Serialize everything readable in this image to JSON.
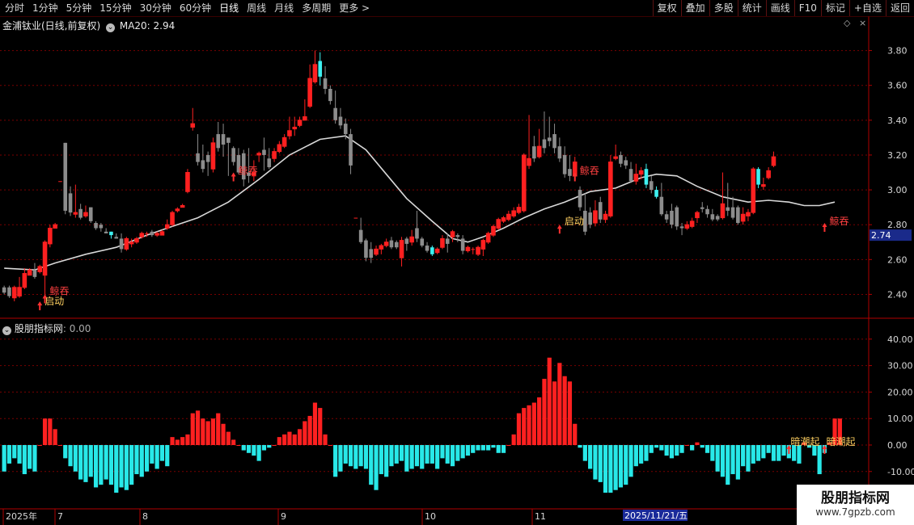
{
  "toolbar": {
    "periods": [
      "分时",
      "1分钟",
      "5分钟",
      "15分钟",
      "30分钟",
      "60分钟",
      "日线",
      "周线",
      "月线",
      "多周期",
      "更多 >"
    ],
    "active_period": "日线",
    "actions": [
      "复权",
      "叠加",
      "多股",
      "统计",
      "画线",
      "F10",
      "标记",
      "+自选",
      "返回"
    ]
  },
  "stock": {
    "name": "金浦钛业(日线,前复权)",
    "ma_label": "MA20: 2.94"
  },
  "indicator": {
    "name": "股朋指标网",
    "value": ": 0.00"
  },
  "price_axis": {
    "ticks": [
      "3.80",
      "3.60",
      "3.40",
      "3.20",
      "3.00",
      "2.80",
      "2.60",
      "2.40"
    ],
    "current": "2.74",
    "range": [
      2.3,
      3.9
    ]
  },
  "osc_axis": {
    "ticks": [
      "40.00",
      "30.00",
      "20.00",
      "10.00",
      "0.00",
      "-10.00"
    ],
    "range": [
      -18,
      43
    ]
  },
  "date_axis": {
    "labels": [
      "2025年",
      "7",
      "8",
      "9",
      "10",
      "11"
    ],
    "cursor_date": "2025/11/21/五"
  },
  "signals": {
    "tunshi": "鲸吞",
    "qidong": "启动",
    "anchaoqi": "暗潮起"
  },
  "watermark": {
    "title": "股朋指标网",
    "url": "www.7gpzb.com"
  },
  "colors": {
    "up": "#ff2020",
    "down_gray": "#8c8c8c",
    "down_cyan": "#3ef0f0",
    "ma": "#d8d8d8",
    "grid": "#7a0000",
    "axis": "#b00000",
    "signal_text": "#ffd060",
    "bar_pos": "#ff2020",
    "bar_neg": "#28e8e8"
  },
  "chart_data": {
    "type": "candlestick",
    "candles": [
      [
        2.44,
        2.41,
        2.45,
        2.4
      ],
      [
        2.44,
        2.39,
        2.45,
        2.38
      ],
      [
        2.38,
        2.44,
        2.45,
        2.36
      ],
      [
        2.39,
        2.44,
        2.5,
        2.38
      ],
      [
        2.44,
        2.52,
        2.55,
        2.43
      ],
      [
        2.51,
        2.54,
        2.55,
        2.51
      ],
      [
        2.54,
        2.5,
        2.58,
        2.49
      ],
      [
        2.53,
        2.56,
        2.57,
        2.52
      ],
      [
        2.51,
        2.7,
        2.71,
        2.37
      ],
      [
        2.69,
        2.78,
        2.8,
        2.67
      ],
      [
        2.78,
        2.8,
        2.81,
        2.78
      ],
      [
        3.05,
        3.05,
        3.05,
        3.05
      ],
      [
        3.27,
        2.88,
        3.27,
        2.86
      ],
      [
        2.98,
        2.87,
        3.02,
        2.85
      ],
      [
        2.86,
        2.87,
        3.03,
        2.84
      ],
      [
        2.89,
        2.84,
        2.92,
        2.83
      ],
      [
        2.85,
        2.87,
        2.91,
        2.84
      ],
      [
        2.9,
        2.82,
        2.9,
        2.81
      ],
      [
        2.81,
        2.78,
        2.82,
        2.77
      ],
      [
        2.8,
        2.78,
        2.81,
        2.76
      ],
      [
        2.76,
        2.75,
        2.78,
        2.75
      ],
      [
        2.76,
        2.74,
        2.76,
        2.72
      ],
      [
        2.73,
        2.72,
        2.75,
        2.72
      ],
      [
        2.72,
        2.66,
        2.75,
        2.64
      ],
      [
        2.66,
        2.72,
        2.73,
        2.65
      ],
      [
        2.69,
        2.7,
        2.72,
        2.67
      ],
      [
        2.7,
        2.72,
        2.73,
        2.69
      ],
      [
        2.73,
        2.75,
        2.76,
        2.72
      ],
      [
        2.75,
        2.75,
        2.76,
        2.73
      ],
      [
        2.76,
        2.74,
        2.77,
        2.73
      ],
      [
        2.74,
        2.75,
        2.76,
        2.73
      ],
      [
        2.74,
        2.76,
        2.77,
        2.74
      ],
      [
        2.78,
        2.8,
        2.83,
        2.77
      ],
      [
        2.8,
        2.87,
        2.88,
        2.79
      ],
      [
        2.88,
        2.89,
        2.9,
        2.87
      ],
      [
        2.9,
        2.91,
        2.92,
        2.9
      ],
      [
        2.99,
        3.1,
        3.12,
        2.98
      ],
      [
        3.36,
        3.38,
        3.47,
        3.34
      ],
      [
        3.21,
        3.16,
        3.32,
        3.14
      ],
      [
        3.17,
        3.12,
        3.26,
        3.1
      ],
      [
        3.2,
        3.16,
        3.22,
        3.08
      ],
      [
        3.12,
        3.27,
        3.3,
        3.1
      ],
      [
        3.32,
        3.24,
        3.39,
        3.22
      ],
      [
        3.32,
        3.26,
        3.38,
        3.19
      ],
      [
        3.3,
        3.27,
        3.3,
        3.08
      ],
      [
        3.24,
        3.16,
        3.25,
        3.14
      ],
      [
        3.2,
        3.1,
        3.24,
        3.09
      ],
      [
        3.21,
        3.06,
        3.23,
        3.02
      ],
      [
        3.1,
        3.08,
        3.24,
        3.04
      ],
      [
        3.08,
        3.1,
        3.17,
        3.05
      ],
      [
        3.2,
        3.21,
        3.22,
        3.16
      ],
      [
        3.23,
        3.2,
        3.3,
        3.11
      ],
      [
        3.18,
        3.13,
        3.24,
        3.12
      ],
      [
        3.18,
        3.22,
        3.24,
        3.16
      ],
      [
        3.22,
        3.26,
        3.28,
        3.21
      ],
      [
        3.25,
        3.3,
        3.32,
        3.24
      ],
      [
        3.31,
        3.34,
        3.42,
        3.29
      ],
      [
        3.35,
        3.36,
        3.42,
        3.31
      ],
      [
        3.37,
        3.4,
        3.42,
        3.36
      ],
      [
        3.4,
        3.42,
        3.52,
        3.4
      ],
      [
        3.48,
        3.64,
        3.72,
        3.47
      ],
      [
        3.62,
        3.72,
        3.8,
        3.61
      ],
      [
        3.74,
        3.65,
        3.79,
        3.6
      ],
      [
        3.64,
        3.58,
        3.71,
        3.55
      ],
      [
        3.58,
        3.51,
        3.6,
        3.49
      ],
      [
        3.47,
        3.4,
        3.57,
        3.38
      ],
      [
        3.42,
        3.37,
        3.47,
        3.35
      ],
      [
        3.38,
        3.32,
        3.41,
        3.29
      ],
      [
        3.32,
        3.14,
        3.35,
        3.09
      ],
      [
        2.84,
        2.84,
        2.84,
        2.84
      ],
      [
        2.77,
        2.7,
        2.84,
        2.69
      ],
      [
        2.71,
        2.61,
        2.72,
        2.59
      ],
      [
        2.66,
        2.61,
        2.7,
        2.58
      ],
      [
        2.63,
        2.66,
        2.68,
        2.62
      ],
      [
        2.66,
        2.68,
        2.69,
        2.63
      ],
      [
        2.68,
        2.7,
        2.72,
        2.67
      ],
      [
        2.71,
        2.67,
        2.73,
        2.66
      ],
      [
        2.7,
        2.67,
        2.71,
        2.66
      ],
      [
        2.61,
        2.71,
        2.73,
        2.56
      ],
      [
        2.72,
        2.69,
        2.73,
        2.65
      ],
      [
        2.7,
        2.73,
        2.77,
        2.68
      ],
      [
        2.78,
        2.72,
        2.88,
        2.7
      ],
      [
        2.72,
        2.68,
        2.73,
        2.67
      ],
      [
        2.68,
        2.65,
        2.7,
        2.64
      ],
      [
        2.67,
        2.63,
        2.68,
        2.62
      ],
      [
        2.64,
        2.66,
        2.67,
        2.63
      ],
      [
        2.67,
        2.72,
        2.74,
        2.66
      ],
      [
        2.72,
        2.69,
        2.75,
        2.64
      ],
      [
        2.73,
        2.76,
        2.77,
        2.7
      ],
      [
        2.74,
        2.73,
        2.75,
        2.7
      ],
      [
        2.72,
        2.65,
        2.74,
        2.63
      ],
      [
        2.65,
        2.67,
        2.68,
        2.64
      ],
      [
        2.66,
        2.66,
        2.67,
        2.63
      ],
      [
        2.63,
        2.67,
        2.68,
        2.62
      ],
      [
        2.66,
        2.71,
        2.72,
        2.62
      ],
      [
        2.7,
        2.75,
        2.76,
        2.69
      ],
      [
        2.74,
        2.79,
        2.8,
        2.73
      ],
      [
        2.78,
        2.83,
        2.84,
        2.77
      ],
      [
        2.82,
        2.84,
        2.85,
        2.81
      ],
      [
        2.83,
        2.86,
        2.88,
        2.82
      ],
      [
        2.85,
        2.88,
        2.9,
        2.84
      ],
      [
        2.87,
        2.9,
        2.92,
        2.86
      ],
      [
        2.88,
        3.2,
        3.21,
        2.87
      ],
      [
        3.14,
        3.18,
        3.43,
        3.12
      ],
      [
        3.25,
        3.18,
        3.31,
        3.16
      ],
      [
        3.19,
        3.25,
        3.35,
        3.18
      ],
      [
        3.29,
        3.24,
        3.45,
        3.21
      ],
      [
        3.3,
        3.28,
        3.42,
        3.25
      ],
      [
        3.32,
        3.24,
        3.38,
        3.21
      ],
      [
        3.25,
        3.18,
        3.3,
        3.16
      ],
      [
        3.2,
        3.09,
        3.25,
        3.07
      ],
      [
        3.12,
        3.08,
        3.2,
        3.05
      ],
      [
        3.08,
        3.16,
        3.19,
        3.06
      ],
      [
        3.0,
        2.9,
        3.02,
        2.88
      ],
      [
        2.88,
        2.76,
        2.98,
        2.74
      ],
      [
        2.87,
        2.8,
        2.9,
        2.78
      ],
      [
        2.81,
        2.88,
        2.94,
        2.79
      ],
      [
        2.93,
        2.83,
        2.96,
        2.81
      ],
      [
        2.83,
        2.86,
        2.88,
        2.81
      ],
      [
        2.85,
        3.16,
        3.2,
        2.84
      ],
      [
        3.18,
        3.19,
        3.26,
        3.17
      ],
      [
        3.2,
        3.15,
        3.22,
        3.13
      ],
      [
        3.17,
        3.14,
        3.19,
        3.12
      ],
      [
        3.12,
        3.05,
        3.16,
        3.04
      ],
      [
        3.05,
        3.09,
        3.15,
        3.03
      ],
      [
        3.09,
        3.11,
        3.13,
        3.06
      ],
      [
        3.12,
        3.03,
        3.15,
        3.01
      ],
      [
        3.05,
        3.0,
        3.08,
        2.98
      ],
      [
        3.0,
        2.96,
        3.02,
        2.95
      ],
      [
        2.96,
        2.86,
        3.04,
        2.85
      ],
      [
        2.86,
        2.83,
        2.88,
        2.81
      ],
      [
        2.88,
        2.8,
        2.92,
        2.78
      ],
      [
        2.9,
        2.79,
        2.91,
        2.77
      ],
      [
        2.79,
        2.78,
        2.81,
        2.74
      ],
      [
        2.78,
        2.8,
        2.82,
        2.77
      ],
      [
        2.79,
        2.82,
        2.84,
        2.78
      ],
      [
        2.84,
        2.87,
        2.88,
        2.81
      ],
      [
        2.9,
        2.89,
        2.93,
        2.87
      ],
      [
        2.89,
        2.86,
        2.91,
        2.84
      ],
      [
        2.86,
        2.83,
        2.89,
        2.82
      ],
      [
        2.85,
        2.83,
        2.86,
        2.82
      ],
      [
        2.84,
        2.92,
        3.1,
        2.83
      ],
      [
        2.9,
        2.88,
        3.04,
        2.85
      ],
      [
        2.9,
        2.84,
        2.96,
        2.83
      ],
      [
        2.9,
        2.81,
        2.91,
        2.8
      ],
      [
        2.82,
        2.86,
        2.9,
        2.8
      ],
      [
        2.85,
        2.87,
        2.89,
        2.82
      ],
      [
        2.87,
        3.12,
        3.13,
        2.86
      ],
      [
        3.12,
        3.03,
        3.13,
        3.01
      ],
      [
        3.02,
        3.03,
        3.07,
        3.0
      ],
      [
        3.07,
        3.11,
        3.13,
        3.06
      ],
      [
        3.14,
        3.19,
        3.22,
        3.13
      ]
    ],
    "ma20": [
      [
        0,
        2.55
      ],
      [
        6,
        2.54
      ],
      [
        10,
        2.58
      ],
      [
        16,
        2.63
      ],
      [
        22,
        2.67
      ],
      [
        28,
        2.74
      ],
      [
        33,
        2.79
      ],
      [
        38,
        2.84
      ],
      [
        44,
        2.93
      ],
      [
        50,
        3.06
      ],
      [
        56,
        3.2
      ],
      [
        62,
        3.29
      ],
      [
        67,
        3.31
      ],
      [
        71,
        3.23
      ],
      [
        75,
        3.09
      ],
      [
        79,
        2.95
      ],
      [
        84,
        2.82
      ],
      [
        88,
        2.72
      ],
      [
        91,
        2.7
      ],
      [
        94,
        2.73
      ],
      [
        98,
        2.78
      ],
      [
        102,
        2.84
      ],
      [
        106,
        2.89
      ],
      [
        110,
        2.93
      ],
      [
        115,
        2.99
      ],
      [
        120,
        3.01
      ],
      [
        125,
        3.07
      ],
      [
        128,
        3.09
      ],
      [
        132,
        3.08
      ],
      [
        136,
        3.02
      ],
      [
        141,
        2.96
      ],
      [
        146,
        2.93
      ],
      [
        150,
        2.94
      ],
      [
        154,
        2.93
      ],
      [
        157,
        2.91
      ],
      [
        160,
        2.91
      ],
      [
        163,
        2.93
      ]
    ],
    "oscillator": [
      -10,
      -7,
      -5,
      -7,
      -11,
      -9,
      -10,
      0,
      10,
      10,
      6,
      0,
      -5,
      -8,
      -10,
      -13,
      -14,
      -12,
      -16,
      -15,
      -13,
      -15,
      -18,
      -16,
      -17,
      -15,
      -11,
      -12,
      -10,
      -7,
      -9,
      -6,
      -8,
      3,
      2,
      3,
      4,
      12,
      13,
      10,
      9,
      10,
      12,
      8,
      5,
      2,
      0,
      -2,
      -3,
      -4,
      -6,
      -2,
      -1,
      0,
      3,
      4,
      5,
      4,
      6,
      9,
      11,
      16,
      14,
      4,
      0,
      -12,
      -10,
      -7,
      -8,
      -9,
      -8,
      -9,
      -15,
      -17,
      -11,
      -12,
      -8,
      -7,
      -6,
      -10,
      -9,
      -8,
      -9,
      -7,
      -7,
      -9,
      -5,
      -7,
      -8,
      -6,
      -5,
      -4,
      -3,
      -2,
      -2,
      -2,
      -1,
      -3,
      -3,
      0,
      4,
      12,
      14,
      15,
      16,
      18,
      25,
      33,
      24,
      31,
      26,
      24,
      8,
      -1,
      -6,
      -9,
      -13,
      -14,
      -18,
      -18,
      -17,
      -16,
      -15,
      -12,
      -8,
      -7,
      -6,
      -3,
      -1,
      -2,
      -4,
      -5,
      -4,
      -3,
      0,
      -2,
      1,
      -1,
      -3,
      -6,
      -10,
      -12,
      -15,
      -11,
      -13,
      -8,
      -10,
      -7,
      -6,
      -5,
      -3,
      -6,
      -6,
      -4,
      -5,
      -6,
      -7,
      1,
      -1,
      -4,
      -11,
      -3,
      1,
      10,
      10
    ],
    "xlabel": "",
    "ylabel": ""
  }
}
